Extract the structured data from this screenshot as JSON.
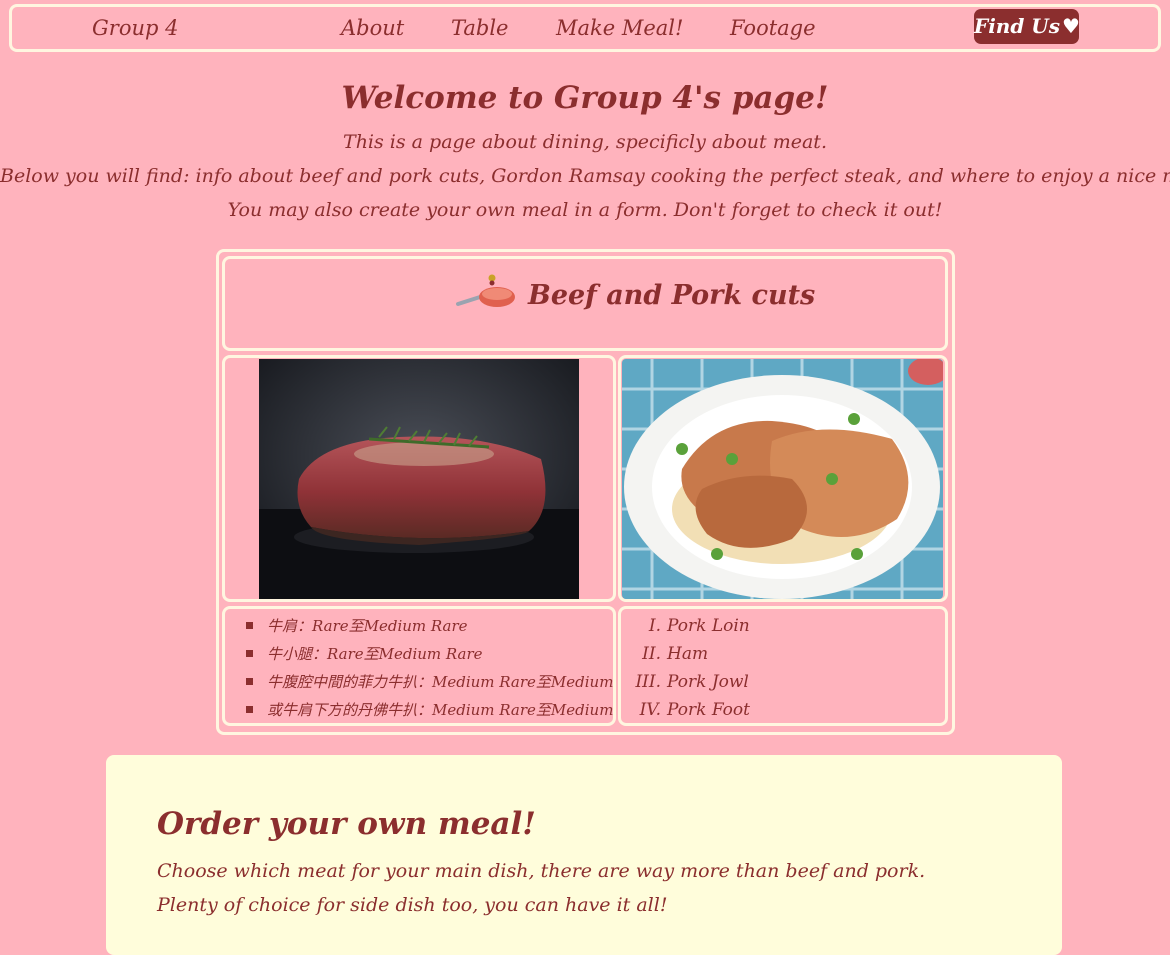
{
  "nav": {
    "brand": "Group 4",
    "links": [
      "About",
      "Table",
      "Make Meal!",
      "Footage"
    ],
    "find_us": "Find Us"
  },
  "welcome": {
    "title": "Welcome to Group 4's page!",
    "lines": [
      "This is a page about dining, specificly about meat.",
      "Below you will find: info about beef and pork cuts, Gordon Ramsay cooking the perfect steak, and where to enjoy a nice meal.",
      "You may also create your own meal in a form. Don't forget to check it out!"
    ]
  },
  "cuts": {
    "title": "Beef and Pork cuts",
    "beef_items": [
      "牛肩：Rare至Medium Rare",
      "牛小腿：Rare至Medium Rare",
      "牛腹腔中間的菲力牛扒：Medium Rare至Medium",
      "或牛肩下方的丹佛牛扒：Medium Rare至Medium"
    ],
    "pork_items": [
      {
        "num": "I.",
        "label": "Pork Loin"
      },
      {
        "num": "II.",
        "label": "Ham"
      },
      {
        "num": "III.",
        "label": "Pork Jowl"
      },
      {
        "num": "IV.",
        "label": "Pork Foot"
      }
    ]
  },
  "order": {
    "title": "Order your own meal!",
    "lines": [
      "Choose which meat for your main dish, there are way more than beef and pork.",
      "Plenty of choice for side dish too, you can have it all!"
    ]
  },
  "colors": {
    "background": "#ffb3bd",
    "text": "#8b2e2e",
    "border": "#fff6e0",
    "panel": "#fffddb",
    "button": "#8b2e2e"
  },
  "icons": [
    "heart-icon",
    "frying-pan-icon"
  ]
}
